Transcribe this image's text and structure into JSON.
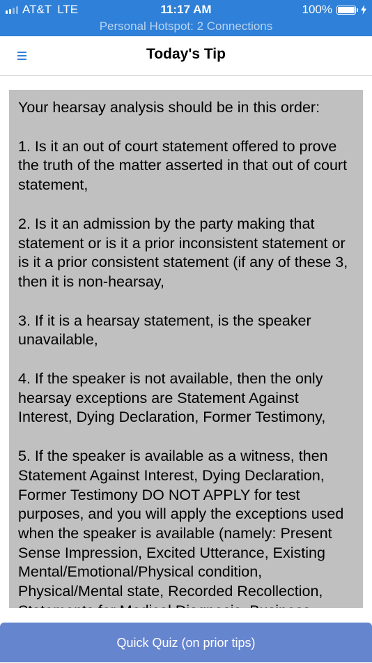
{
  "status_bar": {
    "carrier": "AT&T",
    "network": "LTE",
    "time": "11:17 AM",
    "battery": "100%",
    "hotspot": "Personal Hotspot: 2 Connections",
    "signal_bars_filled": 2,
    "signal_bars_total": 4,
    "battery_level": 1.0,
    "color": "#2f80d8"
  },
  "nav": {
    "title": "Today's Tip",
    "menu_icon": "hamburger-menu-icon"
  },
  "tip": {
    "paragraphs": [
      "Your hearsay analysis should be in this order:",
      "1. Is it an out of court statement offered to prove the truth of the matter asserted in that out of court statement,",
      "2. Is it an admission by the party making that statement or is it a prior inconsistent statement or is it a prior consistent statement (if any of these 3, then it is non-hearsay,",
      "3. If it is a hearsay statement, is the speaker unavailable,",
      "4. If the speaker is not available, then the only hearsay exceptions are Statement Against Interest, Dying Declaration, Former Testimony,",
      "5. If the speaker is available as a witness, then Statement Against Interest, Dying Declaration, Former Testimony DO NOT APPLY for test purposes, and you will apply the exceptions used when the speaker is available (namely: Present Sense Impression, Excited Utterance, Existing Mental/Emotional/Physical condition, Physical/Mental state, Recorded Recollection, Statements for Medical Diagnosis, Business"
    ]
  },
  "footer": {
    "quiz_button_label": "Quick Quiz (on prior tips)",
    "button_color": "#6685cf"
  }
}
